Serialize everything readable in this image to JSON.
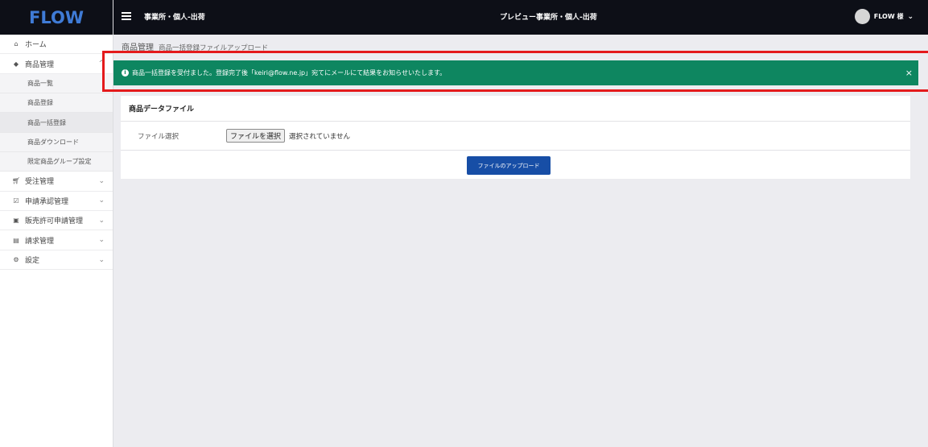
{
  "logo": "FLOW",
  "topbar": {
    "office": "事業所・個人-出荷",
    "preview": "プレビュー事業所・個人-出荷",
    "user": "FLOW 様"
  },
  "sidebar": {
    "items": [
      {
        "label": "ホーム",
        "icon": "home-icon",
        "chevron": false
      },
      {
        "label": "商品管理",
        "icon": "tag-icon",
        "chevron": true
      },
      {
        "label": "受注管理",
        "icon": "cart-icon",
        "chevron": true
      },
      {
        "label": "申請承認管理",
        "icon": "check-square-icon",
        "chevron": true
      },
      {
        "label": "販売許可申請管理",
        "icon": "briefcase-icon",
        "chevron": true
      },
      {
        "label": "請求管理",
        "icon": "document-icon",
        "chevron": true
      },
      {
        "label": "設定",
        "icon": "gear-icon",
        "chevron": true
      }
    ],
    "sub_items": [
      {
        "label": "商品一覧"
      },
      {
        "label": "商品登録"
      },
      {
        "label": "商品一括登録"
      },
      {
        "label": "商品ダウンロード"
      },
      {
        "label": "限定商品グループ設定"
      }
    ]
  },
  "breadcrumb": {
    "title": "商品管理",
    "sub": "商品一括登録ファイルアップロード"
  },
  "alert": {
    "message": "商品一括登録を受付ました。登録完了後「keiri@flow.ne.jp」宛てにメールにて結果をお知らせいたします。",
    "close": "×"
  },
  "card": {
    "title": "商品データファイル",
    "file_label": "ファイル選択",
    "file_button": "ファイルを選択",
    "file_status": "選択されていません",
    "upload_button": "ファイルのアップロード"
  },
  "colors": {
    "alert_bg": "#0e8660",
    "highlight": "#e41a1c",
    "primary_button": "#174ea6",
    "topbar": "#0d0f17"
  }
}
